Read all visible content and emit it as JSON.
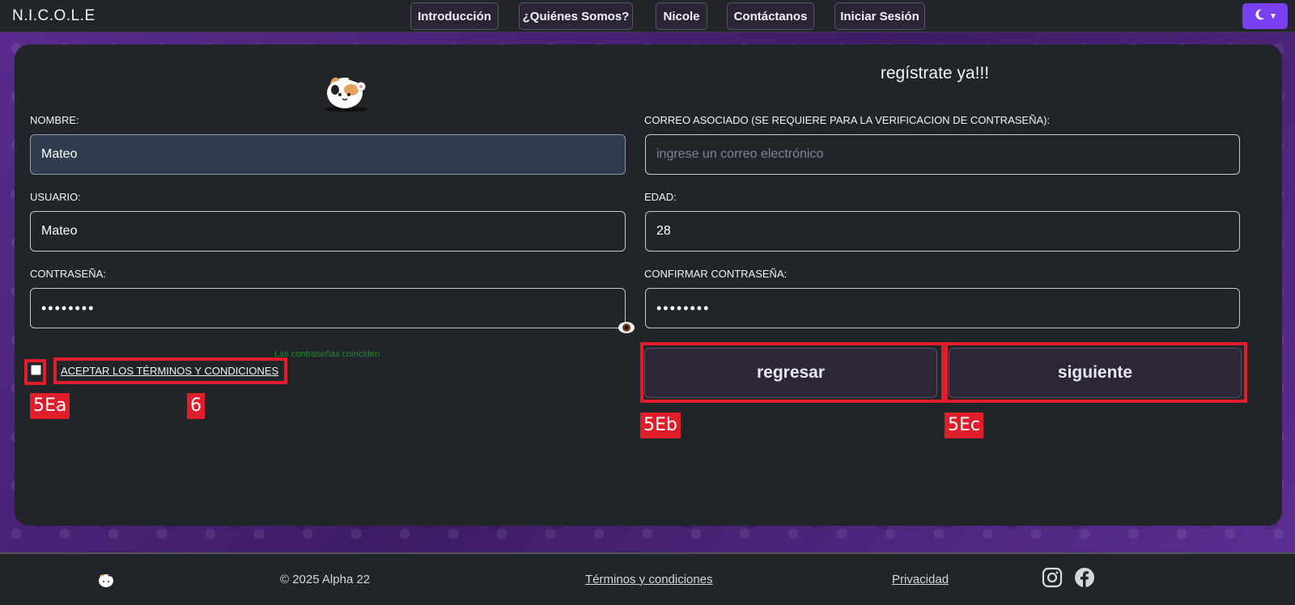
{
  "navbar": {
    "brand": "N.I.C.O.L.E",
    "links": [
      "Introducción",
      "¿Quiénes Somos?",
      "Nicole",
      "Contáctanos",
      "Iniciar Sesión"
    ],
    "theme_icon": "moon-icon"
  },
  "form": {
    "title": "regístrate ya!!!",
    "nombre_label": "NOMBRE:",
    "nombre_value": "Mateo",
    "correo_label": "CORREO ASOCIADO (SE REQUIERE PARA LA VERIFICACION DE CONTRASEÑA):",
    "correo_placeholder": "ingrese un correo electrónico",
    "usuario_label": "USUARIO:",
    "usuario_value": "Mateo",
    "edad_label": "EDAD:",
    "edad_value": "28",
    "password_label": "CONTRASEÑA:",
    "password_value": "••••••••",
    "confirm_label": "CONFIRMAR CONTRASEÑA:",
    "confirm_value": "••••••••",
    "match_message": "Las contraseñas coinciden",
    "terms_label": "ACEPTAR LOS TÉRMINOS Y CONDICIONES",
    "back_button": "regresar",
    "next_button": "siguiente"
  },
  "annotations": {
    "checkbox_tag": "5Ea",
    "terms_tag": "6",
    "back_tag": "5Eb",
    "next_tag": "5Ec"
  },
  "footer": {
    "copyright": "© 2025 Alpha 22",
    "terms_link": "Términos y condiciones",
    "privacy_link": "Privacidad",
    "social_icons": [
      "instagram-icon",
      "facebook-icon"
    ]
  },
  "colors": {
    "accent": "#7b3ff2",
    "annotation": "#e01e2b",
    "success": "#1f8a2c"
  }
}
